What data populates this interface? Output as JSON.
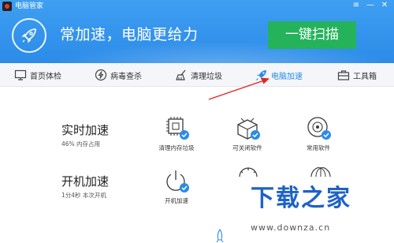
{
  "app": {
    "title": "电脑管家",
    "slogan": "常加速，电脑更给力",
    "scan_button": "一键扫描"
  },
  "nav": {
    "items": [
      {
        "label": "首页体检",
        "icon": "monitor-icon"
      },
      {
        "label": "病毒查杀",
        "icon": "lightning-shield-icon"
      },
      {
        "label": "清理垃圾",
        "icon": "broom-icon"
      },
      {
        "label": "电脑加速",
        "icon": "rocket-icon",
        "active": true
      },
      {
        "label": "工具箱",
        "icon": "toolbox-icon"
      }
    ]
  },
  "realtime": {
    "title": "实时加速",
    "subtitle": "46% 内存占用",
    "tools": [
      {
        "label": "清理内存垃圾",
        "icon": "memory-chip-icon"
      },
      {
        "label": "可关闭软件",
        "icon": "software-box-icon"
      },
      {
        "label": "常用软件",
        "icon": "disc-icon"
      }
    ]
  },
  "startup": {
    "title": "开机加速",
    "subtitle": "1分4秒  本次开机",
    "tools": [
      {
        "label": "开机加速",
        "icon": "power-icon"
      }
    ]
  },
  "watermark": {
    "logo_text": "下载之家",
    "url": "www.downza.cn"
  },
  "colors": {
    "header_blue": "#3f9ff2",
    "scan_green": "#24b35a",
    "accent_blue": "#2b8be8",
    "arrow_red": "#e02424"
  }
}
